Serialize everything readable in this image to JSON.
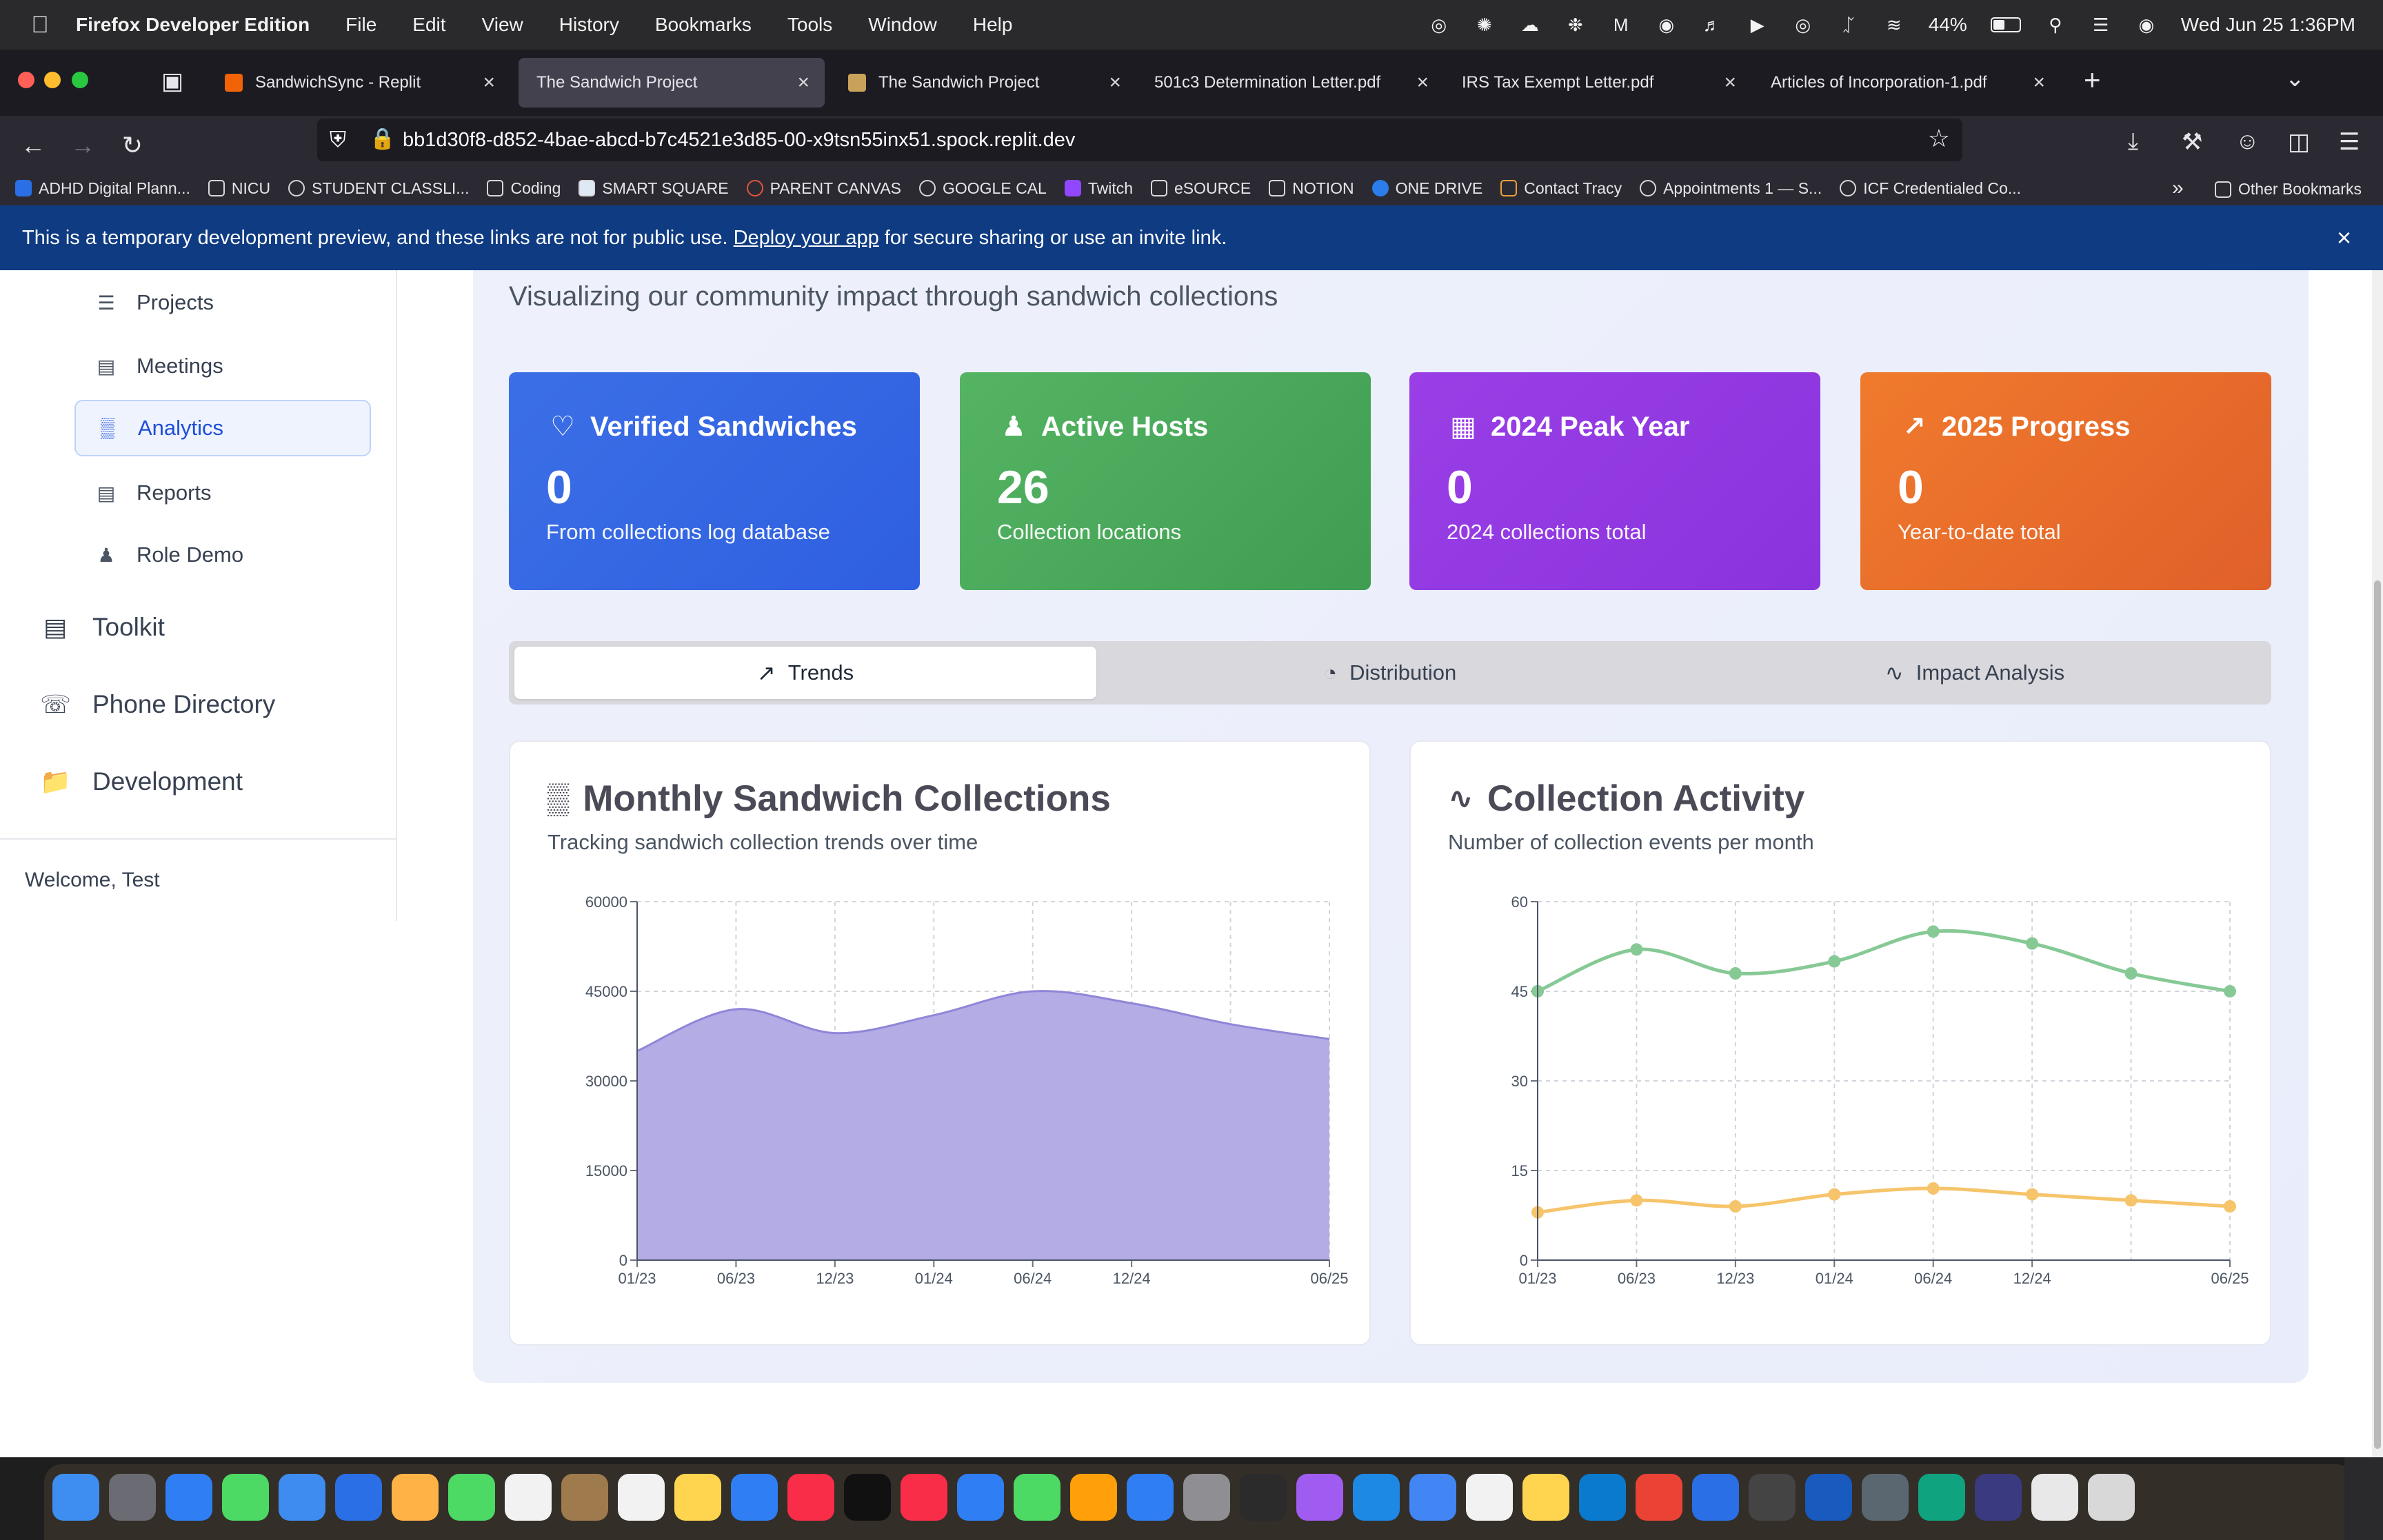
{
  "menubar": {
    "app_name": "Firefox Developer Edition",
    "items": [
      "File",
      "Edit",
      "View",
      "History",
      "Bookmarks",
      "Tools",
      "Window",
      "Help"
    ],
    "battery": "44%",
    "datetime": "Wed Jun 25  1:36PM"
  },
  "browser": {
    "tabs": [
      {
        "title": "SandwichSync - Replit",
        "favicon_color": "#f26207"
      },
      {
        "title": "The Sandwich Project",
        "favicon_color": "#ffffff"
      },
      {
        "title": "The Sandwich Project",
        "favicon_color": "#c9a15a"
      },
      {
        "title": "501c3 Determination Letter.pdf",
        "favicon_color": "#2b2a33"
      },
      {
        "title": "IRS Tax Exempt Letter.pdf",
        "favicon_color": "#2b2a33"
      },
      {
        "title": "Articles of Incorporation-1.pdf",
        "favicon_color": "#2b2a33"
      }
    ],
    "url": "bb1d30f8-d852-4bae-abcd-b7c4521e3d85-00-x9tsn55inx51.spock.replit.dev",
    "bookmarks": [
      "ADHD Digital Plann...",
      "NICU",
      "STUDENT CLASSLI...",
      "Coding",
      "SMART SQUARE",
      "PARENT CANVAS",
      "GOOGLE CAL",
      "Twitch",
      "eSOURCE",
      "NOTION",
      "ONE DRIVE",
      "Contact Tracy",
      "Appointments 1 — S...",
      "ICF Credentialed Co..."
    ],
    "other_bookmarks": "Other Bookmarks"
  },
  "banner": {
    "text_before": "This is a temporary development preview, and these links are not for public use.",
    "link": "Deploy your app",
    "text_after": "for secure sharing or use an invite link."
  },
  "sidebar": {
    "sub_items": [
      {
        "label": "Projects",
        "icon": "list-icon"
      },
      {
        "label": "Meetings",
        "icon": "clipboard-icon"
      },
      {
        "label": "Analytics",
        "icon": "bar-chart-icon",
        "active": true
      },
      {
        "label": "Reports",
        "icon": "file-text-icon"
      },
      {
        "label": "Role Demo",
        "icon": "users-icon"
      }
    ],
    "main_items": [
      {
        "label": "Toolkit",
        "icon": "file-icon"
      },
      {
        "label": "Phone Directory",
        "icon": "phone-icon"
      },
      {
        "label": "Development",
        "icon": "folder-icon"
      }
    ],
    "welcome": "Welcome, Test"
  },
  "main": {
    "subtitle": "Visualizing our community impact through sandwich collections",
    "stats": [
      {
        "title": "Verified Sandwiches",
        "value": "0",
        "desc": "From collections log database",
        "icon": "heart-icon",
        "color_from": "#3b6fe6",
        "color_to": "#2f5fe0"
      },
      {
        "title": "Active Hosts",
        "value": "26",
        "desc": "Collection locations",
        "icon": "users-icon",
        "color_from": "#55b463",
        "color_to": "#3f9d52"
      },
      {
        "title": "2024 Peak Year",
        "value": "0",
        "desc": "2024 collections total",
        "icon": "calendar-icon",
        "color_from": "#9a3fe6",
        "color_to": "#8a33dd"
      },
      {
        "title": "2025 Progress",
        "value": "0",
        "desc": "Year-to-date total",
        "icon": "trending-up-icon",
        "color_from": "#f07a2c",
        "color_to": "#e0602a"
      }
    ],
    "tabs": [
      {
        "label": "Trends",
        "icon": "trending-up-icon",
        "active": true
      },
      {
        "label": "Distribution",
        "icon": "pie-chart-icon"
      },
      {
        "label": "Impact Analysis",
        "icon": "activity-icon"
      }
    ]
  },
  "chart_data": [
    {
      "type": "area",
      "title": "Monthly Sandwich Collections",
      "subtitle": "Tracking sandwich collection trends over time",
      "x_ticks": [
        "01/23",
        "06/23",
        "12/23",
        "01/24",
        "06/24",
        "12/24",
        "06/25"
      ],
      "y_ticks": [
        "0",
        "15000",
        "30000",
        "45000",
        "60000"
      ],
      "ylim": [
        0,
        60000
      ],
      "grid": true,
      "color": "#b0a8e4",
      "series": [
        {
          "x": [
            0,
            1,
            2,
            3,
            4,
            5,
            6,
            7
          ],
          "values": [
            35000,
            42000,
            38000,
            41000,
            45000,
            43000,
            39500,
            37000
          ]
        }
      ]
    },
    {
      "type": "line",
      "title": "Collection Activity",
      "subtitle": "Number of collection events per month",
      "x_ticks": [
        "01/23",
        "06/23",
        "12/23",
        "01/24",
        "06/24",
        "12/24",
        "06/25"
      ],
      "y_ticks": [
        "0",
        "15",
        "30",
        "45",
        "60"
      ],
      "ylim": [
        0,
        60
      ],
      "grid": true,
      "series": [
        {
          "color": "#86c995",
          "x": [
            0,
            1,
            2,
            3,
            4,
            5,
            6,
            7
          ],
          "values": [
            45,
            52,
            48,
            50,
            55,
            53,
            48,
            45
          ]
        },
        {
          "color": "#f6c46a",
          "x": [
            0,
            1,
            2,
            3,
            4,
            5,
            6,
            7
          ],
          "values": [
            8,
            10,
            9,
            11,
            12,
            11,
            10,
            9
          ]
        }
      ]
    }
  ]
}
